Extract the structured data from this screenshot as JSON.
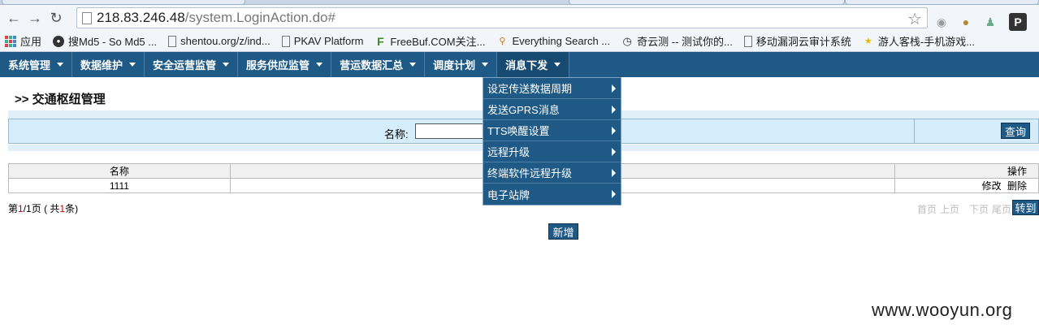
{
  "browser": {
    "url_host": "218.83.246.48",
    "url_path": "/system.LoginAction.do#",
    "bookmarks": [
      {
        "label": "应用",
        "icon": "apps-grid-icon"
      },
      {
        "label": "搜Md5 - So Md5 ...",
        "icon": "somd5-icon"
      },
      {
        "label": "shentou.org/z/ind...",
        "icon": "page-icon"
      },
      {
        "label": "PKAV Platform",
        "icon": "page-icon"
      },
      {
        "label": "FreeBuf.COM关注...",
        "icon": "freebuf-icon"
      },
      {
        "label": "Everything Search ...",
        "icon": "everything-icon"
      },
      {
        "label": "奇云测 -- 测试你的...",
        "icon": "qiyunce-icon"
      },
      {
        "label": "移动漏洞云审计系统",
        "icon": "page-icon"
      },
      {
        "label": "游人客栈-手机游戏...",
        "icon": "youren-icon"
      }
    ]
  },
  "nav": {
    "items": [
      {
        "label": "系统管理"
      },
      {
        "label": "数据维护"
      },
      {
        "label": "安全运营监管"
      },
      {
        "label": "服务供应监管"
      },
      {
        "label": "营运数据汇总"
      },
      {
        "label": "调度计划"
      },
      {
        "label": "消息下发"
      }
    ],
    "active": "消息下发",
    "dropdown": [
      {
        "label": "设定传送数据周期"
      },
      {
        "label": "发送GPRS消息"
      },
      {
        "label": "TTS唤醒设置"
      },
      {
        "label": "远程升级"
      },
      {
        "label": "终端软件远程升级"
      },
      {
        "label": "电子站牌"
      }
    ]
  },
  "page": {
    "title": ">> 交通枢纽管理",
    "search_label": "名称:",
    "search_value": "",
    "query_button": "查询",
    "table": {
      "headers": [
        "名称",
        "",
        "操作"
      ],
      "rows": [
        {
          "name": "1111",
          "edit": "修改",
          "delete": "删除"
        }
      ]
    },
    "pager": {
      "prefix": "第",
      "current": "1",
      "sep": "/",
      "total_pages": "1",
      "mid": "页 ( 共",
      "total": "1",
      "suffix": "条)",
      "first": "首页",
      "prev": "上页",
      "next": "下页",
      "last": "尾页",
      "goto": "转到"
    },
    "add_button": "新增"
  },
  "watermark": "www.wooyun.org",
  "colors": {
    "nav_bg": "#1f5a86",
    "search_bg": "#d5ecfa",
    "pager_number": "#cc0000"
  }
}
